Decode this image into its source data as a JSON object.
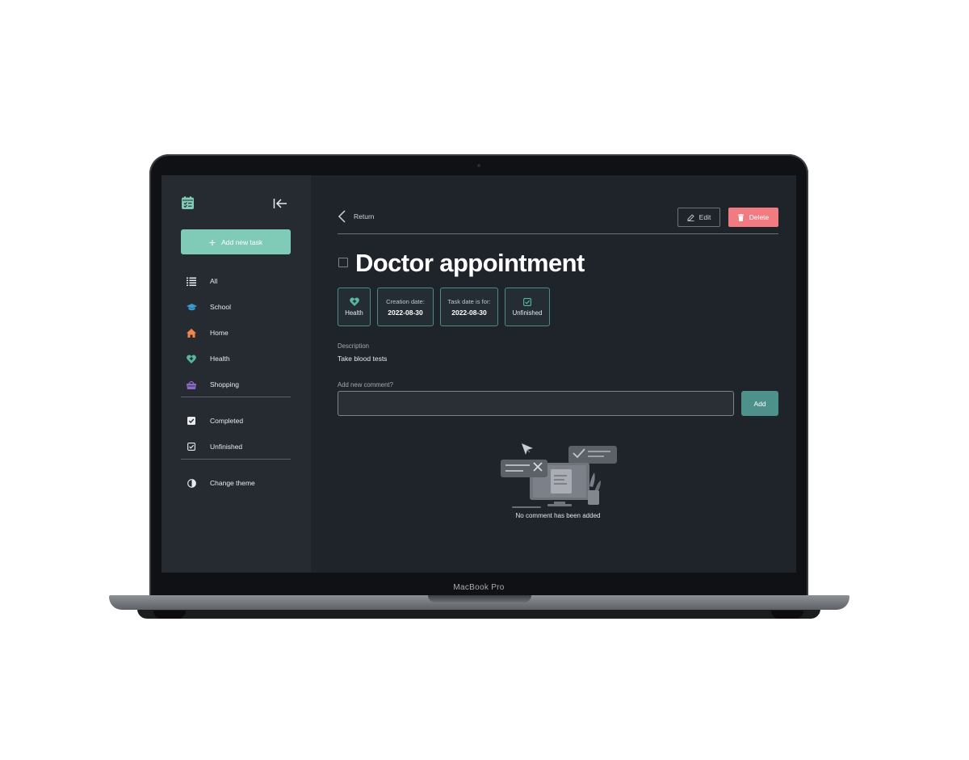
{
  "device": {
    "label": "MacBook Pro"
  },
  "sidebar": {
    "logo_icon": "calendar-check-icon",
    "collapse_icon": "arrow-left-to-line-icon",
    "add_task_label": "Add new task",
    "categories": [
      {
        "label": "All",
        "icon": "list-icon",
        "color": "#e8eaed"
      },
      {
        "label": "School",
        "icon": "graduation-cap-icon",
        "color": "#3d9ad1"
      },
      {
        "label": "Home",
        "icon": "house-icon",
        "color": "#f0864a"
      },
      {
        "label": "Health",
        "icon": "heart-plus-icon",
        "color": "#58b8a4"
      },
      {
        "label": "Shopping",
        "icon": "basket-icon",
        "color": "#8b6bc9"
      }
    ],
    "filters": [
      {
        "label": "Completed",
        "icon": "checkbox-filled-icon"
      },
      {
        "label": "Unfinished",
        "icon": "checkbox-outline-icon"
      }
    ],
    "theme_label": "Change theme"
  },
  "header": {
    "return_label": "Return",
    "edit_label": "Edit",
    "delete_label": "Delete"
  },
  "task": {
    "title": "Doctor appointment",
    "category": "Health",
    "creation_label": "Creation date:",
    "creation_date": "2022-08-30",
    "due_label": "Task date is for:",
    "due_date": "2022-08-30",
    "status": "Unfinished",
    "description_label": "Description",
    "description": "Take blood tests"
  },
  "comments": {
    "label": "Add new comment?",
    "input_value": "",
    "add_label": "Add",
    "empty_text": "No comment has been added"
  },
  "colors": {
    "accent": "#7fcbb8",
    "danger": "#f07b81",
    "add_button": "#4d918a",
    "background": "#1f232a",
    "sidebar": "#262b32"
  }
}
